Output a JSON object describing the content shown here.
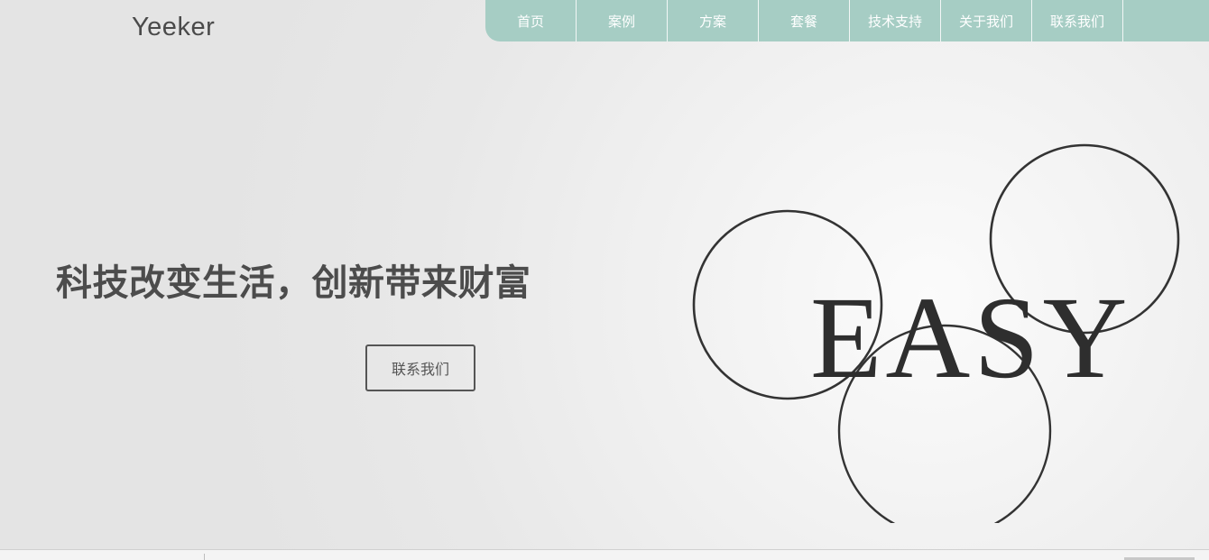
{
  "logo": {
    "text": "Yeeker"
  },
  "nav": {
    "items": [
      {
        "label": "首页"
      },
      {
        "label": "案例"
      },
      {
        "label": "方案"
      },
      {
        "label": "套餐"
      },
      {
        "label": "技术支持"
      },
      {
        "label": "关于我们"
      },
      {
        "label": "联系我们"
      }
    ]
  },
  "hero": {
    "headline": "科技改变生活，创新带来财富",
    "cta_label": "联系我们",
    "art_text": "EASY"
  },
  "colors": {
    "nav_background": "#a6cdc4",
    "text_dark": "#4c4c4c"
  }
}
